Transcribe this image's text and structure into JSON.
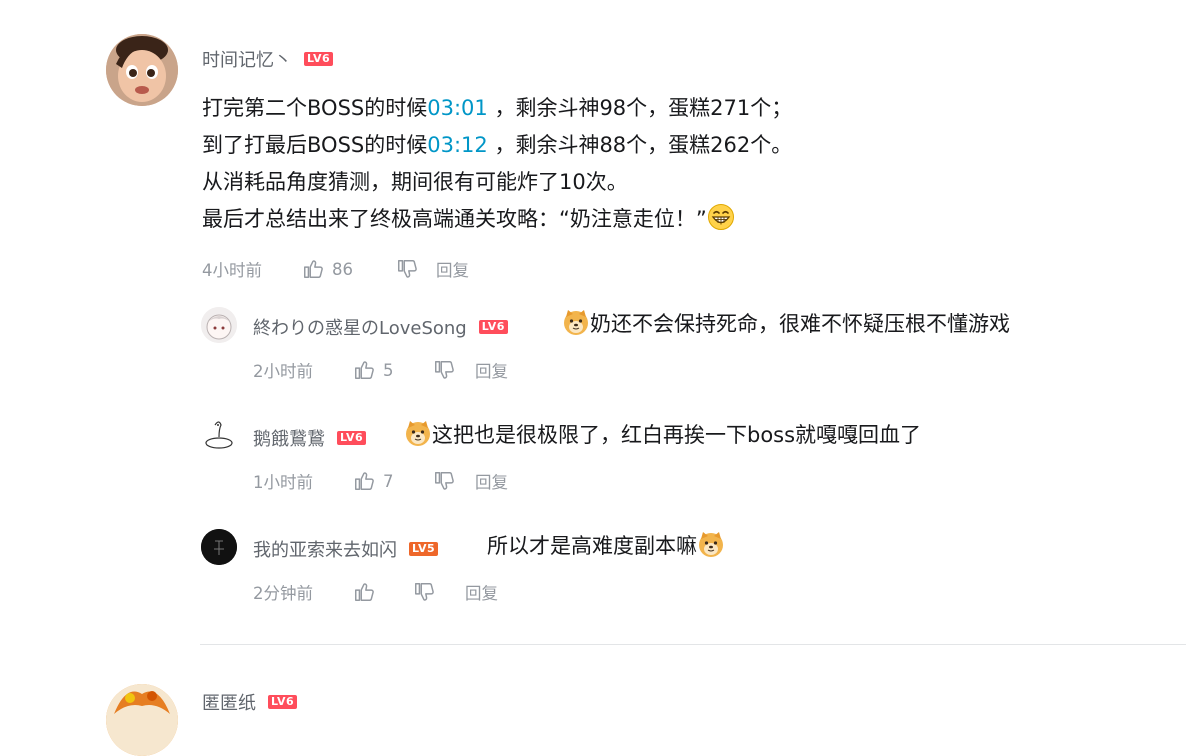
{
  "comments": [
    {
      "username": "时间记忆丶",
      "level": "LV6",
      "lines": [
        {
          "before": "打完第二个BOSS的时候",
          "timestamp": "03:01",
          "after": " ，剩余斗神98个，蛋糕271个；"
        },
        {
          "before": "到了打最后BOSS的时候",
          "timestamp": "03:12",
          "after": " ，剩余斗神88个，蛋糕262个。"
        },
        {
          "text": "从消耗品角度猜测，期间很有可能炸了10次。"
        },
        {
          "text": "最后才总结出来了终极高端通关攻略：“奶注意走位！”"
        }
      ],
      "emoji": "grin-emoji",
      "time": "4小时前",
      "likes": "86",
      "reply_label": "回复"
    },
    {
      "username": "終わりの惑星のLoveSong",
      "level": "LV6",
      "emoji": "doge-emoji",
      "text": "奶还不会保持死命，很难不怀疑压根不懂游戏",
      "time": "2小时前",
      "likes": "5",
      "reply_label": "回复"
    },
    {
      "username": "鹅餓鵞鵞",
      "level": "LV6",
      "emoji": "doge-emoji",
      "text": "这把也是很极限了，红白再挨一下boss就嘎嘎回血了",
      "time": "1小时前",
      "likes": "7",
      "reply_label": "回复"
    },
    {
      "username": "我的亚索来去如闪",
      "level": "LV5",
      "text": "所以才是高难度副本嘛",
      "emoji": "doge-emoji",
      "time": "2分钟前",
      "likes": "",
      "reply_label": "回复"
    },
    {
      "username": "匿匿纸",
      "level": "LV6"
    }
  ],
  "colors": {
    "timestamp_link": "#0096c7",
    "username": "#61666d",
    "meta": "#9499a0",
    "lv6_badge": "#ff4d5b",
    "lv5_badge": "#ee672a"
  }
}
